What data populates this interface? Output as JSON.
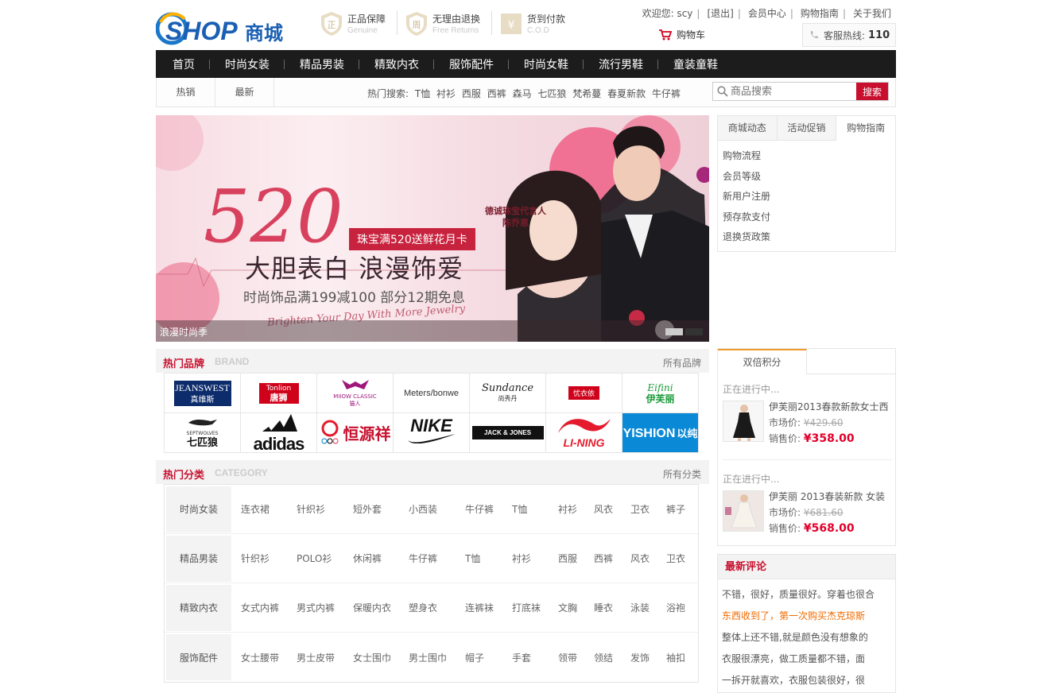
{
  "header": {
    "logo_text": "SHOP商城",
    "badges": [
      {
        "title": "正品保障",
        "sub": "Genuine"
      },
      {
        "title": "无理由退换",
        "sub": "Free Returns"
      },
      {
        "title": "货到付款",
        "sub": "C.O.D"
      }
    ],
    "welcome": "欢迎您: scy",
    "logout": "[退出]",
    "member_center": "会员中心",
    "shopping_guide": "购物指南",
    "about": "关于我们",
    "cart": "购物车",
    "hotline_label": "客服热线:",
    "hotline_number": "110"
  },
  "nav": [
    "首页",
    "时尚女装",
    "精品男装",
    "精致内衣",
    "服饰配件",
    "时尚女鞋",
    "流行男鞋",
    "童装童鞋"
  ],
  "subbar": {
    "tabs": [
      "热销",
      "最新"
    ],
    "hot_search_label": "热门搜索:",
    "hot_search": [
      "T恤",
      "衬衫",
      "西服",
      "西裤",
      "森马",
      "七匹狼",
      "梵希蔓",
      "春夏新款",
      "牛仔裤"
    ],
    "search_placeholder": "商品搜索",
    "search_button": "搜索"
  },
  "banner": {
    "number": "520",
    "tag": "珠宝满520送鲜花月卡",
    "title": "大胆表白 浪漫饰爱",
    "subtitle": "时尚饰品满199减100 部分12期免息",
    "script": "Brighten Your Day With More Jewelry",
    "spokes": [
      "德诚珠宝代言人",
      "陈乔恩"
    ],
    "caption": "浪漫时尚季"
  },
  "info_panel": {
    "tabs": [
      "商城动态",
      "活动促销",
      "购物指南"
    ],
    "items": [
      "购物流程",
      "会员等级",
      "新用户注册",
      "预存款支付",
      "退换货政策"
    ]
  },
  "brands": {
    "title": "热门品牌",
    "title_en": "BRAND",
    "more": "所有品牌",
    "items": [
      {
        "name": "JEANSWEST",
        "cn": "真维斯"
      },
      {
        "name": "Tonlion",
        "cn": "唐狮"
      },
      {
        "name": "MIIOW CLASSIC",
        "cn": "猫人"
      },
      {
        "name": "Meters/bonwe",
        "cn": ""
      },
      {
        "name": "Sundance",
        "cn": "尚秀丹"
      },
      {
        "name": "",
        "cn": "忧衣依"
      },
      {
        "name": "Eifini",
        "cn": "伊芙丽"
      },
      {
        "name": "SEPTWOLVES",
        "cn": "七匹狼"
      },
      {
        "name": "adidas",
        "cn": ""
      },
      {
        "name": "",
        "cn": "恒源祥"
      },
      {
        "name": "NIKE",
        "cn": ""
      },
      {
        "name": "JACK & JONES",
        "cn": ""
      },
      {
        "name": "LI-NING",
        "cn": ""
      },
      {
        "name": "YISHION",
        "cn": "以纯"
      }
    ]
  },
  "categories": {
    "title": "热门分类",
    "title_en": "CATEGORY",
    "more": "所有分类",
    "rows": [
      {
        "name": "时尚女装",
        "items": [
          "连衣裙",
          "针织衫",
          "短外套",
          "小西装",
          "牛仔裤",
          "T恤",
          "衬衫",
          "风衣",
          "卫衣",
          "裤子"
        ]
      },
      {
        "name": "精品男装",
        "items": [
          "针织衫",
          "POLO衫",
          "休闲裤",
          "牛仔裤",
          "T恤",
          "衬衫",
          "西服",
          "西裤",
          "风衣",
          "卫衣"
        ]
      },
      {
        "name": "精致内衣",
        "items": [
          "女式内裤",
          "男式内裤",
          "保暖内衣",
          "塑身衣",
          "连裤袜",
          "打底袜",
          "文胸",
          "睡衣",
          "泳装",
          "浴袍"
        ]
      },
      {
        "name": "服饰配件",
        "items": [
          "女士腰带",
          "男士皮带",
          "女士围巾",
          "男士围巾",
          "帽子",
          "手套",
          "领带",
          "领结",
          "发饰",
          "袖扣"
        ]
      }
    ]
  },
  "double_points": {
    "tab": "双倍积分",
    "products": [
      {
        "status": "正在进行中...",
        "name": "伊芙丽2013春款新款女士西",
        "market_label": "市场价:",
        "market_price": "¥429.60",
        "sale_label": "销售价:",
        "sale_price": "¥358.00"
      },
      {
        "status": "正在进行中...",
        "name": "伊芙丽 2013春装新款 女装",
        "market_label": "市场价:",
        "market_price": "¥681.60",
        "sale_label": "销售价:",
        "sale_price": "¥568.00"
      }
    ]
  },
  "comments": {
    "title": "最新评论",
    "items": [
      "不错，很好，质量很好。穿着也很合",
      "东西收到了，第一次购买杰克琼斯",
      "整体上还不错,就是颜色没有想象的",
      "衣服很漂亮，做工质量都不错，面",
      "一拆开就喜欢，衣服包装很好，很"
    ]
  },
  "colors": {
    "accent": "#c8102e",
    "nav_bg": "#1c1c1c",
    "highlight": "#f06b00",
    "tab_border": "#f29b2c"
  }
}
